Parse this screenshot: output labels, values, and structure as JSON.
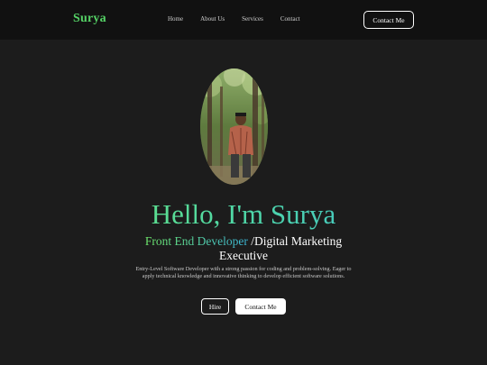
{
  "nav": {
    "brand": "Surya",
    "links": [
      "Home",
      "About Us",
      "Services",
      "Contact"
    ],
    "cta": "Contact Me"
  },
  "hero": {
    "title": "Hello, I'm Surya",
    "role_accent": "Front End Developer",
    "role_rest": " /Digital Marketing Executive",
    "description": "Entry-Level Software Developer with a strong passion for coding and problem-solving. Eager to apply technical knowledge and innovative thinking to develop efficient software solutions.",
    "hire_label": "Hire",
    "contact_label": "Contact Me",
    "photo_alt": "profile-photo"
  },
  "colors": {
    "background": "#1c1c1c",
    "navbar": "#111111",
    "brand_green": "#55d266",
    "gradient_start": "#6ee86a",
    "gradient_end": "#3bb6d8"
  }
}
